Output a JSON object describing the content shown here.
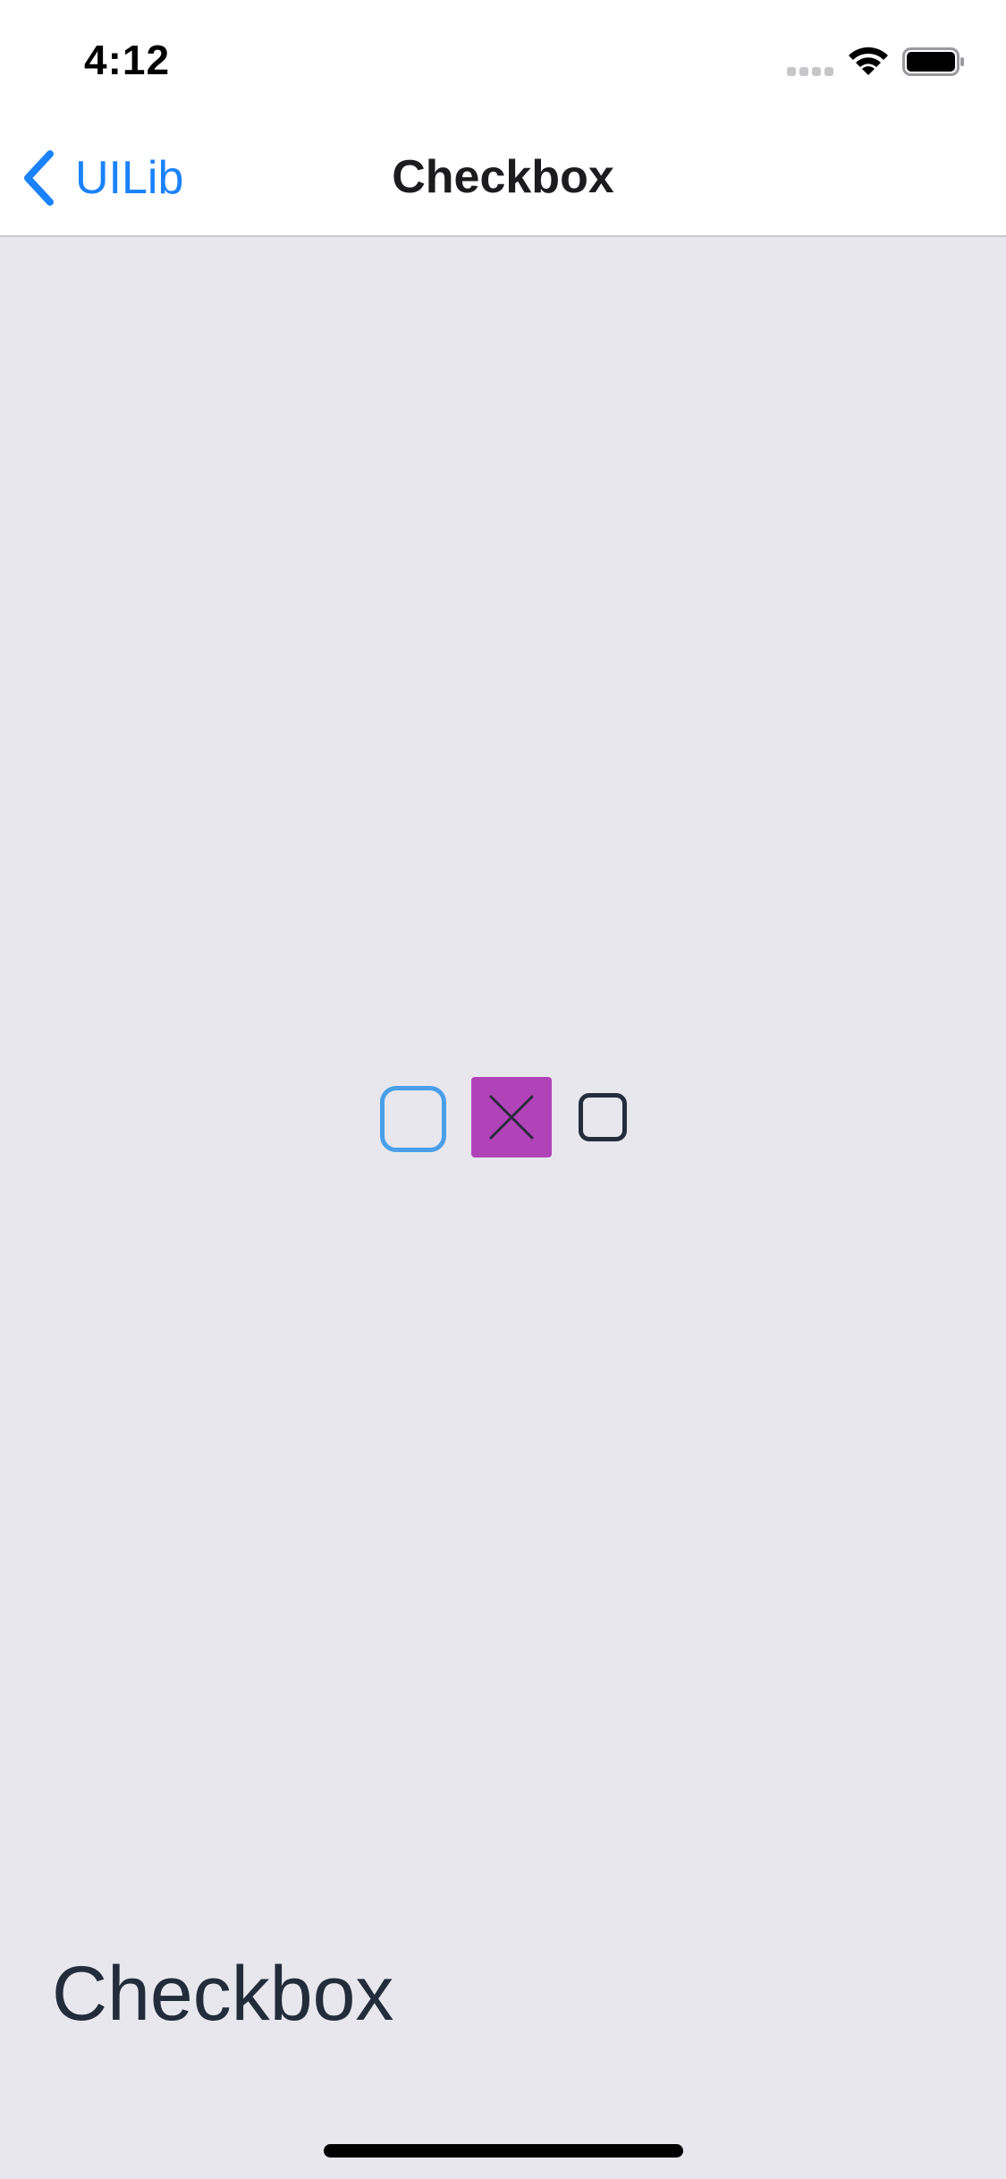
{
  "status_bar": {
    "time": "4:12",
    "icons": [
      "signal-icon",
      "wifi-icon",
      "battery-icon"
    ]
  },
  "nav": {
    "back_label": "UILib",
    "title": "Checkbox"
  },
  "checkboxes": [
    {
      "name": "checkbox-blue",
      "checked": false,
      "color": "#4a9fe8"
    },
    {
      "name": "checkbox-magenta",
      "checked": true,
      "color": "#b043b8",
      "icon": "close-x-icon"
    },
    {
      "name": "checkbox-dark",
      "checked": false,
      "color": "#232d3b"
    }
  ],
  "screen": {
    "heading": "Checkbox"
  },
  "colors": {
    "background": "#e8e7ee",
    "accent": "#1a82fb"
  }
}
